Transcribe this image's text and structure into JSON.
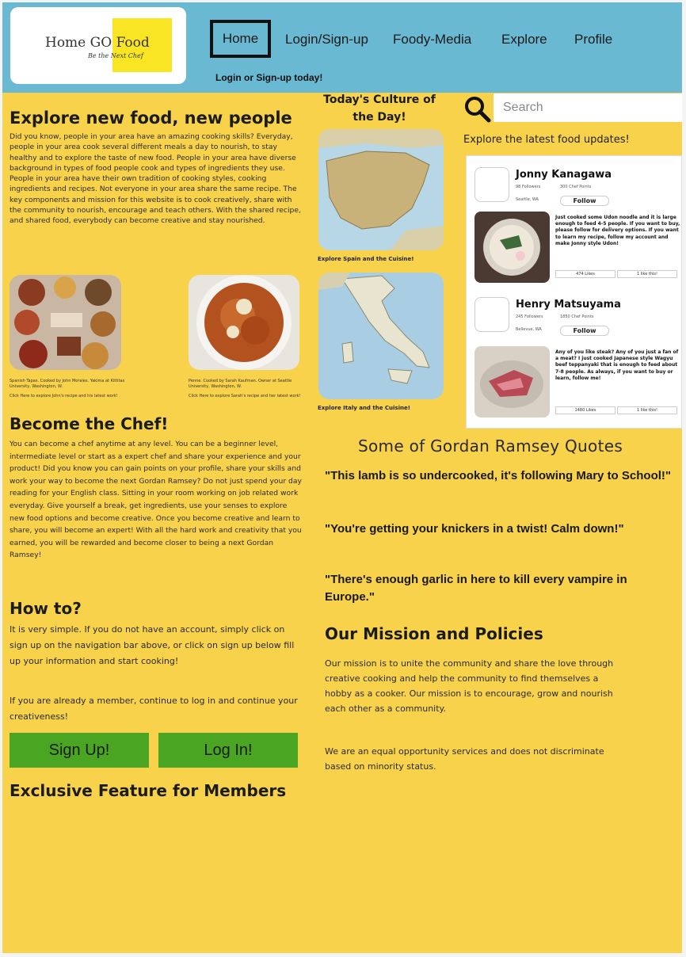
{
  "header": {
    "logo_title": "Home GO Food",
    "logo_tagline": "Be the Next Chef",
    "nav": [
      "Home",
      "Login/Sign-up",
      "Foody-Media",
      "Explore",
      "Profile"
    ],
    "subtext": "Login or Sign-up today!"
  },
  "explore": {
    "title": "Explore new food, new people",
    "body": "Did you know, people in your area have an amazing cooking skills? Everyday, people in your area cook several different meals a day to nourish, to stay healthy and to explore the taste of new food. People in your area have diverse background in types of food people cook and types of ingredients they use. People in your area have their own tradition of cooking styles, cooking ingredients and recipes. Not everyone in your area share the same recipe. The key components and mission for this website is to cook creatively, share with the community to nourish, encourage and teach others. With the shared recipe, and shared food, everybody can become creative and stay nourished.",
    "img1_caption": "Spanish Tapas. Cooked by John Morales. Yakima at Kittitas University, Washington, W.",
    "img1_link": "Click Here to explore John's recipe and his latest work!",
    "img2_caption": "Penne. Cooked by Sarah Kaufman. Owner at Seattle University, Washington, W.",
    "img2_link": "Click Here to explore Sarah's recipe and her latest work!"
  },
  "culture": {
    "title": "Today's Culture of the Day!",
    "spain_caption": "Explore Spain and the Cuisine!",
    "italy_caption": "Explore Italy and the Cuisine!"
  },
  "search": {
    "placeholder": "Search"
  },
  "feed": {
    "heading": "Explore the latest food updates!",
    "posts": [
      {
        "name": "Jonny Kanagawa",
        "followers": "98 Followers",
        "points": "300 Chef Points",
        "location": "Seattle, WA",
        "follow_label": "Follow",
        "text": "Just cooked some Udon noodle and it is large enough to feed 4-5 people. If you want to buy, please follow for delivery options. If you want to learn my recipe, follow my account and make Jonny style Udon!",
        "likes": "474 Likes",
        "other": "1 like this!"
      },
      {
        "name": "Henry Matsuyama",
        "followers": "245 Followers",
        "points": "1850 Chef Points",
        "location": "Bellevue, WA",
        "follow_label": "Follow",
        "text": "Any of you like steak? Any of you just a fan of a meat? I just cooked Japanese style Wagyu beef teppanyaki that is enough to feed about 7-8 people. As always, if you want to buy or learn, follow me!",
        "likes": "1480 Likes",
        "other": "1 like this!"
      }
    ]
  },
  "chef": {
    "title": "Become the Chef!",
    "body": "You can become a chef anytime at any level. You can be a beginner level, intermediate level or start as a expert chef and share your experience and your product! Did you know you can gain points on your profile, share your skills and work your way to become the next Gordan Ramsey? Do not just spend your day reading for your English class. Sitting in your room working on job related work everyday. Give yourself a break, get ingredients, use your senses to explore new food options and become creative. Once you become creative and learn to share, you will become an expert! With all the hard work and creativity that you earned, you will be rewarded and become closer to being a next Gordan Ramsey!"
  },
  "howto": {
    "title": "How to?",
    "para1": "It is very simple. If you do not have an account, simply click on sign up on the navigation bar above, or click on sign up below fill up your information and start cooking!",
    "para2": "If you are already a member, continue to log in and continue your creativeness!",
    "signup_label": "Sign Up!",
    "login_label": "Log In!"
  },
  "exclusive": {
    "title": "Exclusive Feature for Members"
  },
  "quotes": {
    "title": "Some of Gordan Ramsey Quotes",
    "items": [
      "\"This lamb is so undercooked, it's following Mary to School!\"",
      "\"You're getting your knickers in a twist! Calm down!\"",
      "\"There's enough garlic in here to kill every vampire in Europe.\""
    ]
  },
  "mission": {
    "title": "Our Mission and Policies",
    "para1": "Our mission is to unite the community and share the love through creative cooking and help the community to find themselves a hobby as a cooker. Our mission is to encourage, grow and nourish each other as a community.",
    "para2": "We are an equal opportunity services and does not discriminate based on minority status."
  },
  "colors": {
    "background": "#f8d24a",
    "header": "#69b9d2",
    "button": "#4aa522",
    "logo_accent": "#f9e524"
  }
}
